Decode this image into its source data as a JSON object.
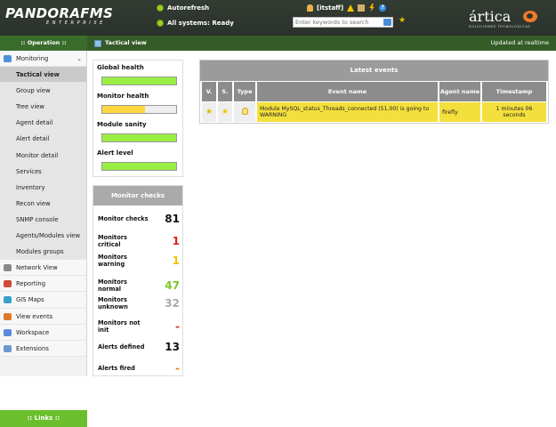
{
  "header": {
    "brand": "PANDORAFMS",
    "brand_sub": "ENTERPRISE",
    "autorefresh": "Autorefresh",
    "systems_status": "All systems: Ready",
    "user": "[itstaff]",
    "search_placeholder": "Enter keywords to search",
    "artica_name": "ártica",
    "artica_tag": "SOLUCIONES TECNOLÓGICAS"
  },
  "topbar": {
    "operation": ":: Operation ::",
    "page_title": "Tactical view",
    "updated": "Updated at realtime"
  },
  "sidebar": {
    "items": [
      {
        "label": "Monitoring",
        "type": "main",
        "icon": "monitoring-icon"
      },
      {
        "label": "Tactical view",
        "type": "sub",
        "active": true
      },
      {
        "label": "Group view",
        "type": "sub"
      },
      {
        "label": "Tree view",
        "type": "sub"
      },
      {
        "label": "Agent detail",
        "type": "sub"
      },
      {
        "label": "Alert detail",
        "type": "sub"
      },
      {
        "label": "Monitor detail",
        "type": "sub"
      },
      {
        "label": "Services",
        "type": "sub"
      },
      {
        "label": "Inventory",
        "type": "sub"
      },
      {
        "label": "Recon view",
        "type": "sub"
      },
      {
        "label": "SNMP console",
        "type": "sub"
      },
      {
        "label": "Agents/Modules view",
        "type": "sub"
      },
      {
        "label": "Modules groups",
        "type": "sub"
      },
      {
        "label": "Network View",
        "type": "main",
        "icon": "network-icon"
      },
      {
        "label": "Reporting",
        "type": "main",
        "icon": "reporting-icon"
      },
      {
        "label": "GIS Maps",
        "type": "main",
        "icon": "gis-icon"
      },
      {
        "label": "View events",
        "type": "main",
        "icon": "events-icon"
      },
      {
        "label": "Workspace",
        "type": "main",
        "icon": "workspace-icon"
      },
      {
        "label": "Extensions",
        "type": "main",
        "icon": "extensions-icon"
      }
    ],
    "links": ":: Links ::"
  },
  "health": {
    "items": [
      {
        "label": "Global health",
        "percent": 100,
        "color": "#99ee44"
      },
      {
        "label": "Monitor health",
        "percent": 58,
        "color": "#ffd740"
      },
      {
        "label": "Module sanity",
        "percent": 100,
        "color": "#99ee44"
      },
      {
        "label": "Alert level",
        "percent": 100,
        "color": "#99ee44"
      }
    ]
  },
  "monitor_checks": {
    "title": "Monitor checks",
    "rows": [
      {
        "label": "Monitor checks",
        "value": "81",
        "color": "#111111"
      },
      {
        "label": "Monitors critical",
        "value": "1",
        "color": "#e02020"
      },
      {
        "label": "Monitors warning",
        "value": "1",
        "color": "#f0c000"
      },
      {
        "label": "Monitors normal",
        "value": "47",
        "color": "#7cc52a"
      },
      {
        "label": "Monitors unknown",
        "value": "32",
        "color": "#aaaaaa"
      },
      {
        "label": "Monitors not init",
        "value": "-",
        "color": "#e03030"
      },
      {
        "label": "Alerts defined",
        "value": "13",
        "color": "#111111"
      },
      {
        "label": "Alerts fired",
        "value": "-",
        "color": "#f08020"
      }
    ]
  },
  "events": {
    "title": "Latest events",
    "columns": [
      "V.",
      "S.",
      "Type",
      "Event name",
      "Agent name",
      "Timestamp"
    ],
    "rows": [
      {
        "event_name": "Module MySQL_status_Threads_connected (51.00) is going to WARNING",
        "agent": "firefly",
        "timestamp": "1 minutes 06 seconds"
      }
    ]
  },
  "colors": {
    "header_bg": "#2e352e",
    "green_bar": "#355c28",
    "links_bar": "#6bbf2c",
    "warning_row": "#f4e03c"
  }
}
